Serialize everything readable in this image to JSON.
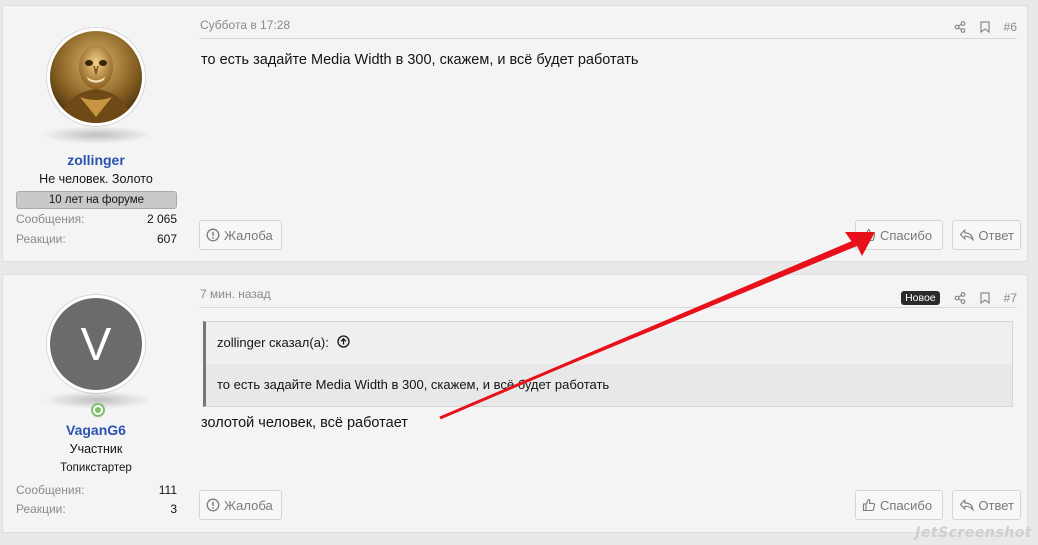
{
  "posts": [
    {
      "author": "zollinger",
      "user_title": "Не человек. Золото",
      "banner": "10 лет на форуме",
      "stats": [
        {
          "label": "Сообщения:",
          "value": "2 065"
        },
        {
          "label": "Реакции:",
          "value": "607"
        }
      ],
      "date": "Суббота в 17:28",
      "number": "#6",
      "text": "то есть задайте Media Width в 300, скажем, и всё будет работать",
      "report_label": "Жалоба",
      "like_label": "Спасибо",
      "reply_label": "Ответ"
    },
    {
      "author": "VaganG6",
      "avatar_letter": "V",
      "user_title": "Участник",
      "user_subtitle": "Топикстартер",
      "stats": [
        {
          "label": "Сообщения:",
          "value": "111"
        },
        {
          "label": "Реакции:",
          "value": "3"
        }
      ],
      "date": "7 мин. назад",
      "new_badge": "Новое",
      "number": "#7",
      "quote_author": "zollinger сказал(а):",
      "quote_text": "то есть задайте Media Width в 300, скажем, и всё будет работать",
      "text": "золотой человек, всё работает",
      "report_label": "Жалоба",
      "like_label": "Спасибо",
      "reply_label": "Ответ"
    }
  ],
  "watermark": "JetScreenshot",
  "colors": {
    "username": "#2b52b0",
    "arrow": "#e8101a",
    "online": "#7fbf6b"
  }
}
